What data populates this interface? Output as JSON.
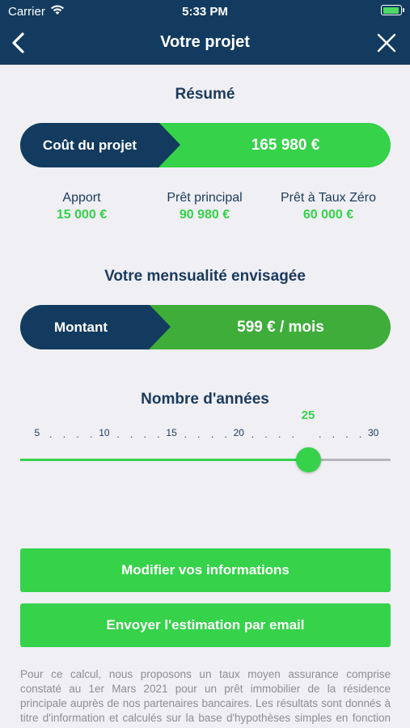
{
  "status_bar": {
    "carrier": "Carrier",
    "time": "5:33 PM"
  },
  "nav": {
    "title": "Votre projet",
    "back_icon": "chevron-left-icon",
    "close_icon": "close-icon"
  },
  "summary": {
    "title": "Résumé",
    "cost_label": "Coût du projet",
    "cost_value": "165 980 €",
    "items": [
      {
        "label": "Apport",
        "value": "15 000 €"
      },
      {
        "label": "Prêt principal",
        "value": "90 980 €"
      },
      {
        "label": "Prêt à Taux Zéro",
        "value": "60 000 €"
      }
    ]
  },
  "monthly": {
    "title": "Votre mensualité envisagée",
    "amount_label": "Montant",
    "amount_value": "599 € / mois"
  },
  "years": {
    "title": "Nombre d'années",
    "value": "25",
    "min": 5,
    "max": 30,
    "current": 25,
    "ticks": [
      "5",
      ".",
      ".",
      ".",
      ".",
      "10",
      ".",
      ".",
      ".",
      ".",
      "15",
      ".",
      ".",
      ".",
      ".",
      "20",
      ".",
      ".",
      ".",
      ".",
      "25",
      ".",
      ".",
      ".",
      ".",
      "30"
    ]
  },
  "buttons": {
    "modify": "Modifier vos informations",
    "send": "Envoyer l'estimation par email"
  },
  "disclaimer": "Pour ce calcul, nous proposons un taux moyen assurance comprise constaté au 1er Mars 2021 pour un prêt immobilier de la résidence principale auprès de nos partenaires bancaires. Les résultats sont donnés à titre d'information et calculés sur la base d'hypothèses simples en fonction des informations",
  "colors": {
    "navy": "#133b5f",
    "green": "#35d24a",
    "dark_green": "#3fad3a",
    "background": "#efeff4"
  }
}
